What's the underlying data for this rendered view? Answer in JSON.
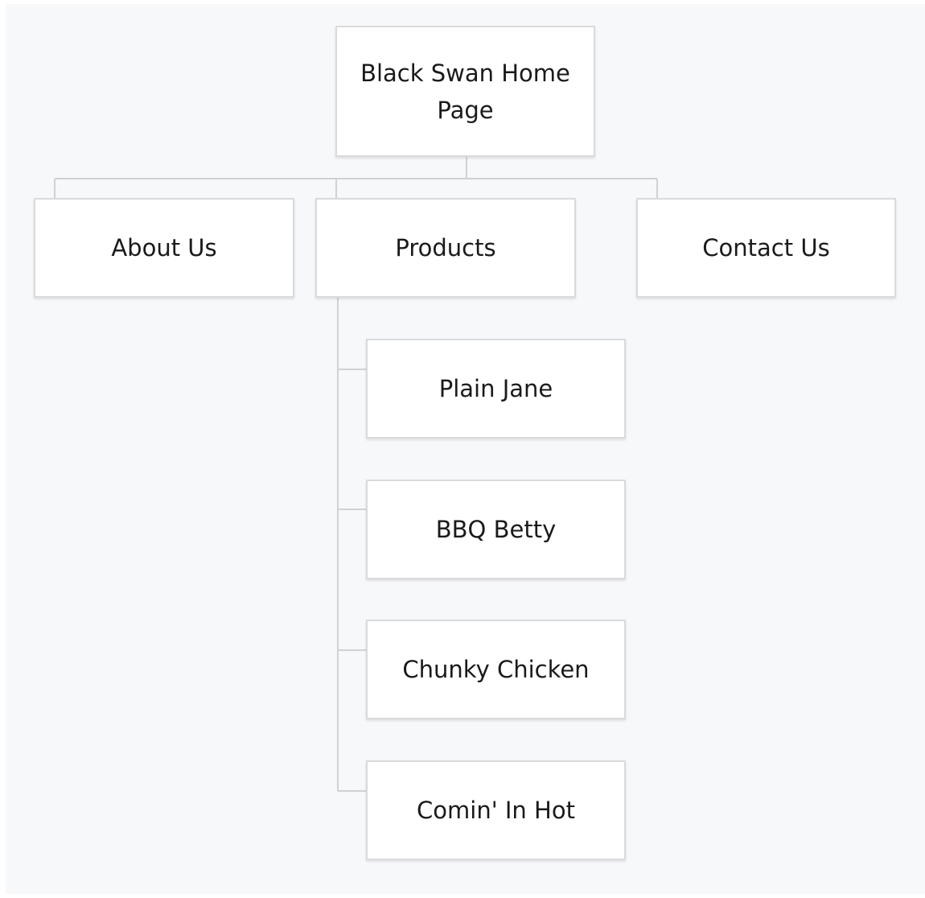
{
  "sitemap": {
    "root": "Black Swan Home Page",
    "sections": [
      "About Us",
      "Products",
      "Contact Us"
    ],
    "products": [
      "Plain Jane",
      "BBQ Betty",
      "Chunky Chicken",
      "Comin' In Hot"
    ]
  },
  "colors": {
    "background": "#f7f8fa",
    "node_fill": "#ffffff",
    "node_border": "#d9dadc",
    "connector": "#cfd1d4",
    "text": "#1a1a1a"
  }
}
